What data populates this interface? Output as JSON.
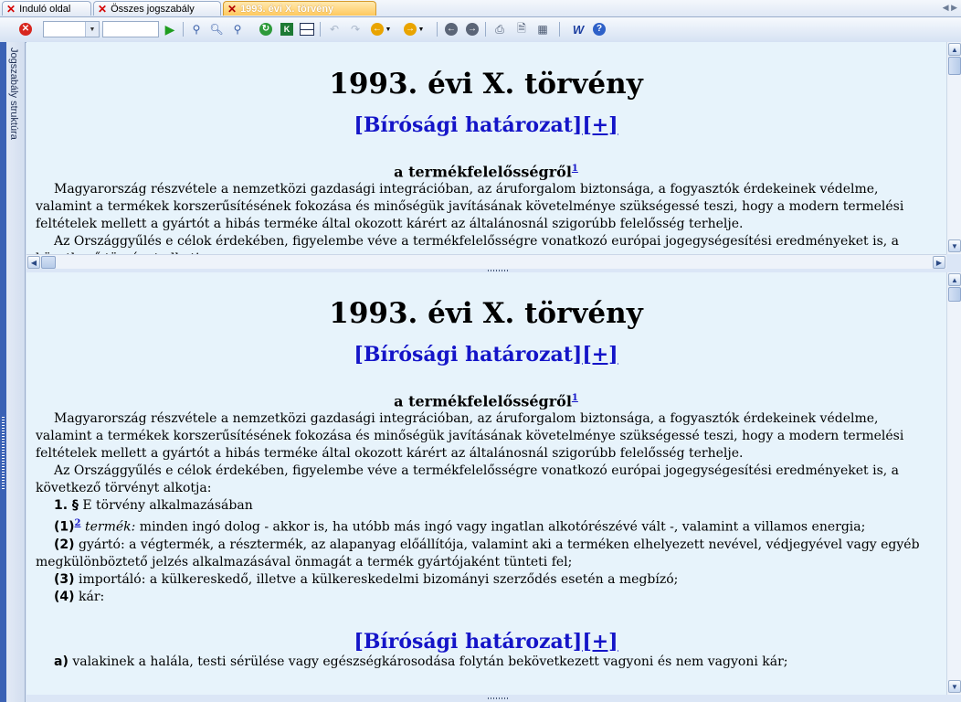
{
  "tabs": [
    {
      "label": "Induló oldal",
      "active": false
    },
    {
      "label": "Összes jogszabály",
      "active": false
    },
    {
      "label": "1993. évi X. törvény",
      "active": true
    }
  ],
  "sidebar": {
    "label": "Jogszabály struktúra"
  },
  "document": {
    "title": "1993. évi X. törvény",
    "court_link": "[Bírósági határozat]",
    "court_plus": "[+]",
    "subtitle": "a termékfelelősségről",
    "subtitle_fn": "1",
    "para1": "Magyarország részvétele a nemzetközi gazdasági integrációban, az áruforgalom biztonsága, a fogyasztók érdekeinek védelme, valamint a termékek korszerűsítésének fokozása és minőségük javításának követelménye szükségessé teszi, hogy a modern termelési feltételek mellett a gyártót a hibás terméke által okozott kárért az általánosnál szigorúbb felelősség terhelje.",
    "para2": "Az Országgyűlés e célok érdekében, figyelembe véve a termékfelelősségre vonatkozó európai jogegységesítési eredményeket is, a következő törvényt alkotja:",
    "sec1_num": "1. §",
    "sec1_text": "E törvény alkalmazásában",
    "item1_num": "(1)",
    "item1_fn": "2",
    "item1_term": "termék:",
    "item1_text": "minden ingó dolog - akkor is, ha utóbb más ingó vagy ingatlan alkotórészévé vált -, valamint a villamos energia;",
    "item2_num": "(2)",
    "item2_text": "gyártó: a végtermék, a résztermék, az alapanyag előállítója, valamint aki a terméken elhelyezett nevével, védjegyével vagy egyéb megkülönböztető jelzés alkalmazásával önmagát a termék gyártójaként tünteti fel;",
    "item3_num": "(3)",
    "item3_text": "importáló: a külkereskedő, illetve a külkereskedelmi bizományi szerződés esetén a megbízó;",
    "item4_num": "(4)",
    "item4_text": "kár:",
    "itema_num": "a)",
    "itema_text": "valakinek a halála, testi sérülése vagy egészségkárosodása folytán bekövetkezett vagyoni és nem vagyoni kár;"
  }
}
